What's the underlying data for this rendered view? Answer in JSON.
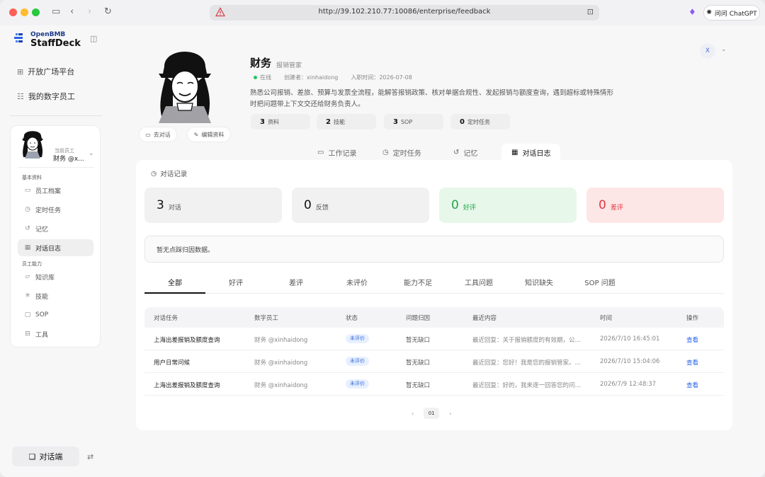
{
  "browser": {
    "url": "http://39.102.210.77:10086/enterprise/feedback",
    "chatgpt_label": "问问 ChatGPT"
  },
  "brand": {
    "top": "OpenBMB",
    "main": "StaffDeck"
  },
  "sidebar": {
    "nav": [
      {
        "label": "开放广场平台",
        "icon": "grid-icon"
      },
      {
        "label": "我的数字员工",
        "icon": "people-icon"
      }
    ],
    "employee": {
      "role": "当前员工",
      "name": "财务 @x..."
    },
    "sections": [
      {
        "label": "基本资料"
      },
      {
        "label": "员工能力"
      }
    ],
    "items": [
      {
        "label": "员工档案",
        "icon": "id-card-icon"
      },
      {
        "label": "定时任务",
        "icon": "clock-icon"
      },
      {
        "label": "记忆",
        "icon": "history-icon"
      },
      {
        "label": "对话日志",
        "icon": "calendar-icon"
      },
      {
        "label": "知识库",
        "icon": "folder-icon"
      },
      {
        "label": "技能",
        "icon": "sparkle-icon"
      },
      {
        "label": "SOP",
        "icon": "chat-square-icon"
      },
      {
        "label": "工具",
        "icon": "toolbox-icon"
      }
    ],
    "chat_button": "对话端"
  },
  "profile": {
    "name": "财务",
    "role": "报销管家",
    "status": "在线",
    "creator": "创建者：xinhaidong",
    "joined": "入职时间：2026-07-08",
    "description": "熟悉公司报销、差旅、预算与发票全流程，能解答报销政策、核对单据合规性、发起报销与额度查询，遇到超标或特殊情形时把问题带上下文交还给财务负责人。",
    "chips": [
      {
        "num": "3",
        "label": "资料"
      },
      {
        "num": "2",
        "label": "技能"
      },
      {
        "num": "3",
        "label": "SOP"
      },
      {
        "num": "0",
        "label": "定时任务"
      }
    ],
    "go_chat": "去对话",
    "edit": "编辑资料",
    "user_initial": "X"
  },
  "tabs": [
    {
      "label": "工作记录",
      "icon": "monitor-icon"
    },
    {
      "label": "定时任务",
      "icon": "clock-icon"
    },
    {
      "label": "记忆",
      "icon": "history-icon"
    },
    {
      "label": "对话日志",
      "icon": "calendar-icon"
    }
  ],
  "panel": {
    "title": "对话记录",
    "metrics": [
      {
        "num": "3",
        "label": "对话"
      },
      {
        "num": "0",
        "label": "反馈"
      },
      {
        "num": "0",
        "label": "好评"
      },
      {
        "num": "0",
        "label": "差评"
      }
    ],
    "empty_text": "暂无点踩归因数据。",
    "filters": [
      "全部",
      "好评",
      "差评",
      "未评价",
      "能力不足",
      "工具问题",
      "知识缺失",
      "SOP 问题"
    ],
    "columns": [
      "对话任务",
      "数字员工",
      "状态",
      "问题归因",
      "最近内容",
      "时间",
      "操作"
    ],
    "rows": [
      {
        "task": "上海出差报销及额度查询",
        "employee": "财务 @xinhaidong",
        "status": "未评价",
        "cause": "暂无缺口",
        "recent": "最近回复：关于报销额度的有效期，公…",
        "time": "2026/7/10 16:45:01",
        "action": "查看"
      },
      {
        "task": "用户日常问候",
        "employee": "财务 @xinhaidong",
        "status": "未评价",
        "cause": "暂无缺口",
        "recent": "最近回复：您好！我是您的报销管家。…",
        "time": "2026/7/10 15:04:06",
        "action": "查看"
      },
      {
        "task": "上海出差报销及额度查询",
        "employee": "财务 @xinhaidong",
        "status": "未评价",
        "cause": "暂无缺口",
        "recent": "最近回复：好的，我来逐一回答您的问…",
        "time": "2026/7/9 12:48:37",
        "action": "查看"
      }
    ],
    "page": "01"
  }
}
